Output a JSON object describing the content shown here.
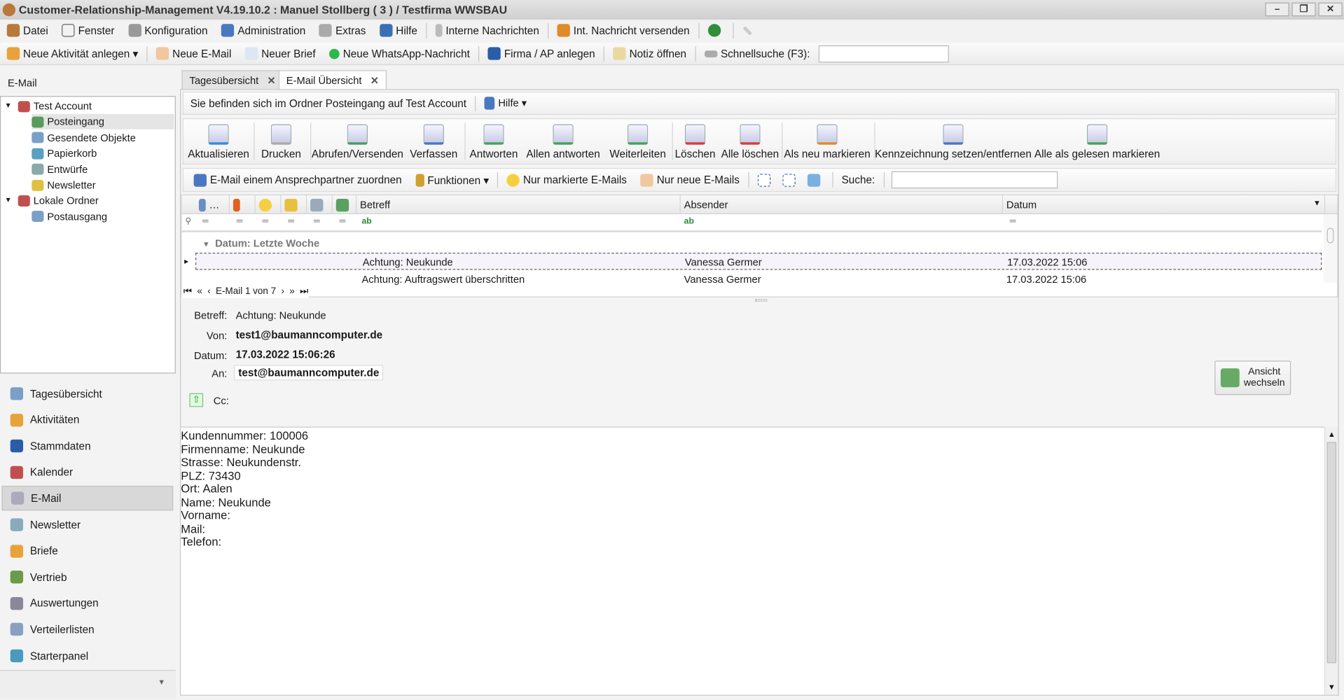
{
  "window": {
    "title": "Customer-Relationship-Management V4.19.10.2 : Manuel Stollberg ( 3 ) / Testfirma WWSBAU",
    "min": "–",
    "restore": "❐",
    "close": "✕"
  },
  "menu": [
    "Datei",
    "Fenster",
    "Konfiguration",
    "Administration",
    "Extras",
    "Hilfe",
    "Interne Nachrichten",
    "Int. Nachricht versenden"
  ],
  "toolbar": {
    "items": [
      "Neue Aktivität anlegen ▾",
      "Neue E-Mail",
      "Neuer Brief",
      "Neue WhatsApp-Nachricht",
      "Firma / AP anlegen",
      "Notiz öffnen",
      "Schnellsuche (F3):"
    ],
    "search_value": ""
  },
  "left": {
    "title": "E-Mail",
    "tree": [
      {
        "label": "Test Account",
        "level": 0
      },
      {
        "label": "Posteingang",
        "level": 1,
        "selected": true
      },
      {
        "label": "Gesendete Objekte",
        "level": 1
      },
      {
        "label": "Papierkorb",
        "level": 1
      },
      {
        "label": "Entwürfe",
        "level": 1
      },
      {
        "label": "Newsletter",
        "level": 1
      },
      {
        "label": "Lokale Ordner",
        "level": 0
      },
      {
        "label": "Postausgang",
        "level": 1
      }
    ],
    "nav": [
      "Tagesübersicht",
      "Aktivitäten",
      "Stammdaten",
      "Kalender",
      "E-Mail",
      "Newsletter",
      "Briefe",
      "Vertrieb",
      "Auswertungen",
      "Verteilerlisten",
      "Starterpanel"
    ],
    "nav_selected": "E-Mail"
  },
  "tabs": [
    {
      "label": "Tagesübersicht"
    },
    {
      "label": "E-Mail Übersicht",
      "active": true
    }
  ],
  "breadcrumb": {
    "text": "Sie befinden sich im Ordner Posteingang auf Test Account",
    "help": "Hilfe ▾"
  },
  "ribbon": [
    "Aktualisieren",
    "Drucken",
    "Abrufen/Versenden",
    "Verfassen",
    "Antworten",
    "Allen antworten",
    "Weiterleiten",
    "Löschen",
    "Alle löschen",
    "Als neu markieren",
    "Kennzeichnung setzen/entfernen",
    "Alle als gelesen markieren"
  ],
  "filterbar": {
    "assign": "E-Mail einem Ansprechpartner zuordnen",
    "functions": "Funktionen ▾",
    "marked": "Nur markierte E-Mails",
    "new": "Nur neue E-Mails",
    "search_label": "Suche:",
    "search_value": ""
  },
  "grid": {
    "columns": [
      "Betreff",
      "Absender",
      "Datum"
    ],
    "group": "Datum: Letzte Woche",
    "rows": [
      {
        "subject": "Achtung: Neukunde",
        "sender": "Vanessa Germer",
        "date": "17.03.2022 15:06"
      },
      {
        "subject": "Achtung: Auftragswert überschritten",
        "sender": "Vanessa Germer",
        "date": "17.03.2022 15:06"
      }
    ],
    "pager": "E-Mail 1 von 7"
  },
  "detail": {
    "subject_label": "Betreff:",
    "subject": "Achtung: Neukunde",
    "from_label": "Von:",
    "from": "test1@baumanncomputer.de",
    "date_label": "Datum:",
    "date": "17.03.2022 15:06:26",
    "to_label": "An:",
    "to": "test@baumanncomputer.de",
    "cc_label": "Cc:",
    "view_btn": "Ansicht wechseln"
  },
  "body": [
    "Kundennummer: 100006",
    "Firmenname: Neukunde",
    "Strasse: Neukundenstr.",
    "PLZ: 73430",
    "Ort: Aalen",
    "Name: Neukunde",
    "Vorname:",
    "Mail:",
    "Telefon:"
  ]
}
